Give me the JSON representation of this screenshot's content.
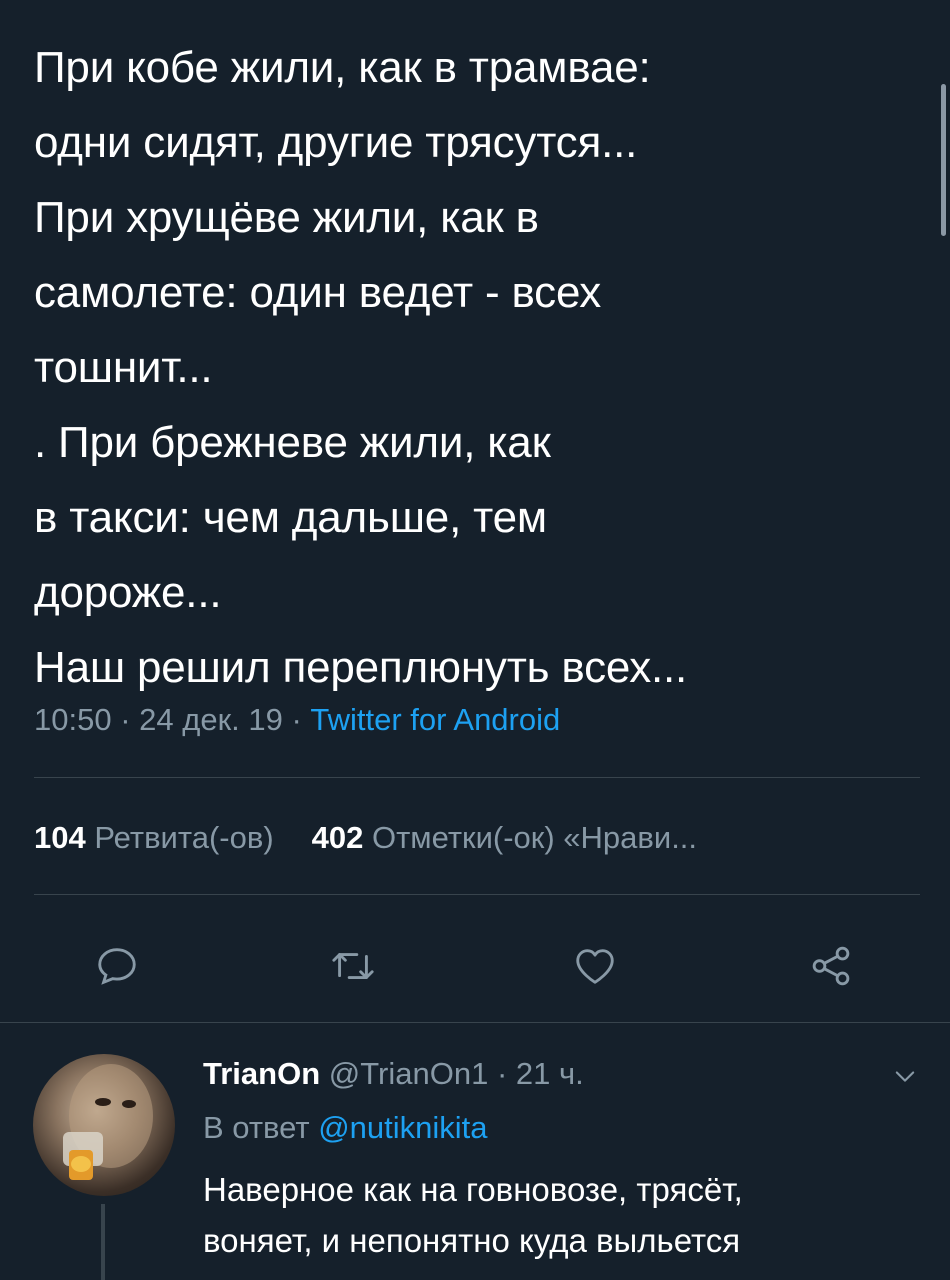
{
  "tweet": {
    "lines": [
      "При кобе жили, как в трамвае:",
      "одни сидят, другие трясутся...",
      "При хрущёве жили, как в",
      "самолете: один ведет - всех",
      "тошнит...",
      ". При брежневе жили, как",
      "в такси: чем дальше, тем",
      "дороже...",
      "Наш решил переплюнуть всех..."
    ],
    "time": "10:50",
    "date": "24 дек. 19",
    "source": "Twitter for Android",
    "retweets_count": "104",
    "retweets_label": "Ретвита(-ов)",
    "likes_count": "402",
    "likes_label": "Отметки(-ок) «Нрави..."
  },
  "actions": {
    "reply_icon": "comment-icon",
    "retweet_icon": "retweet-icon",
    "like_icon": "heart-icon",
    "share_icon": "share-icon"
  },
  "reply": {
    "name": "TrianOn",
    "handle": "@TrianOn1",
    "time": "21 ч.",
    "reply_prefix": "В ответ",
    "reply_mention": "@nutiknikita",
    "lines": [
      "Наверное как на говновозе, трясёт,",
      "воняет, и непонятно куда выльется"
    ]
  },
  "colors": {
    "background": "#15202b",
    "text": "#ffffff",
    "secondary": "#8899a6",
    "accent": "#1da1f2",
    "divider": "#38444d"
  }
}
